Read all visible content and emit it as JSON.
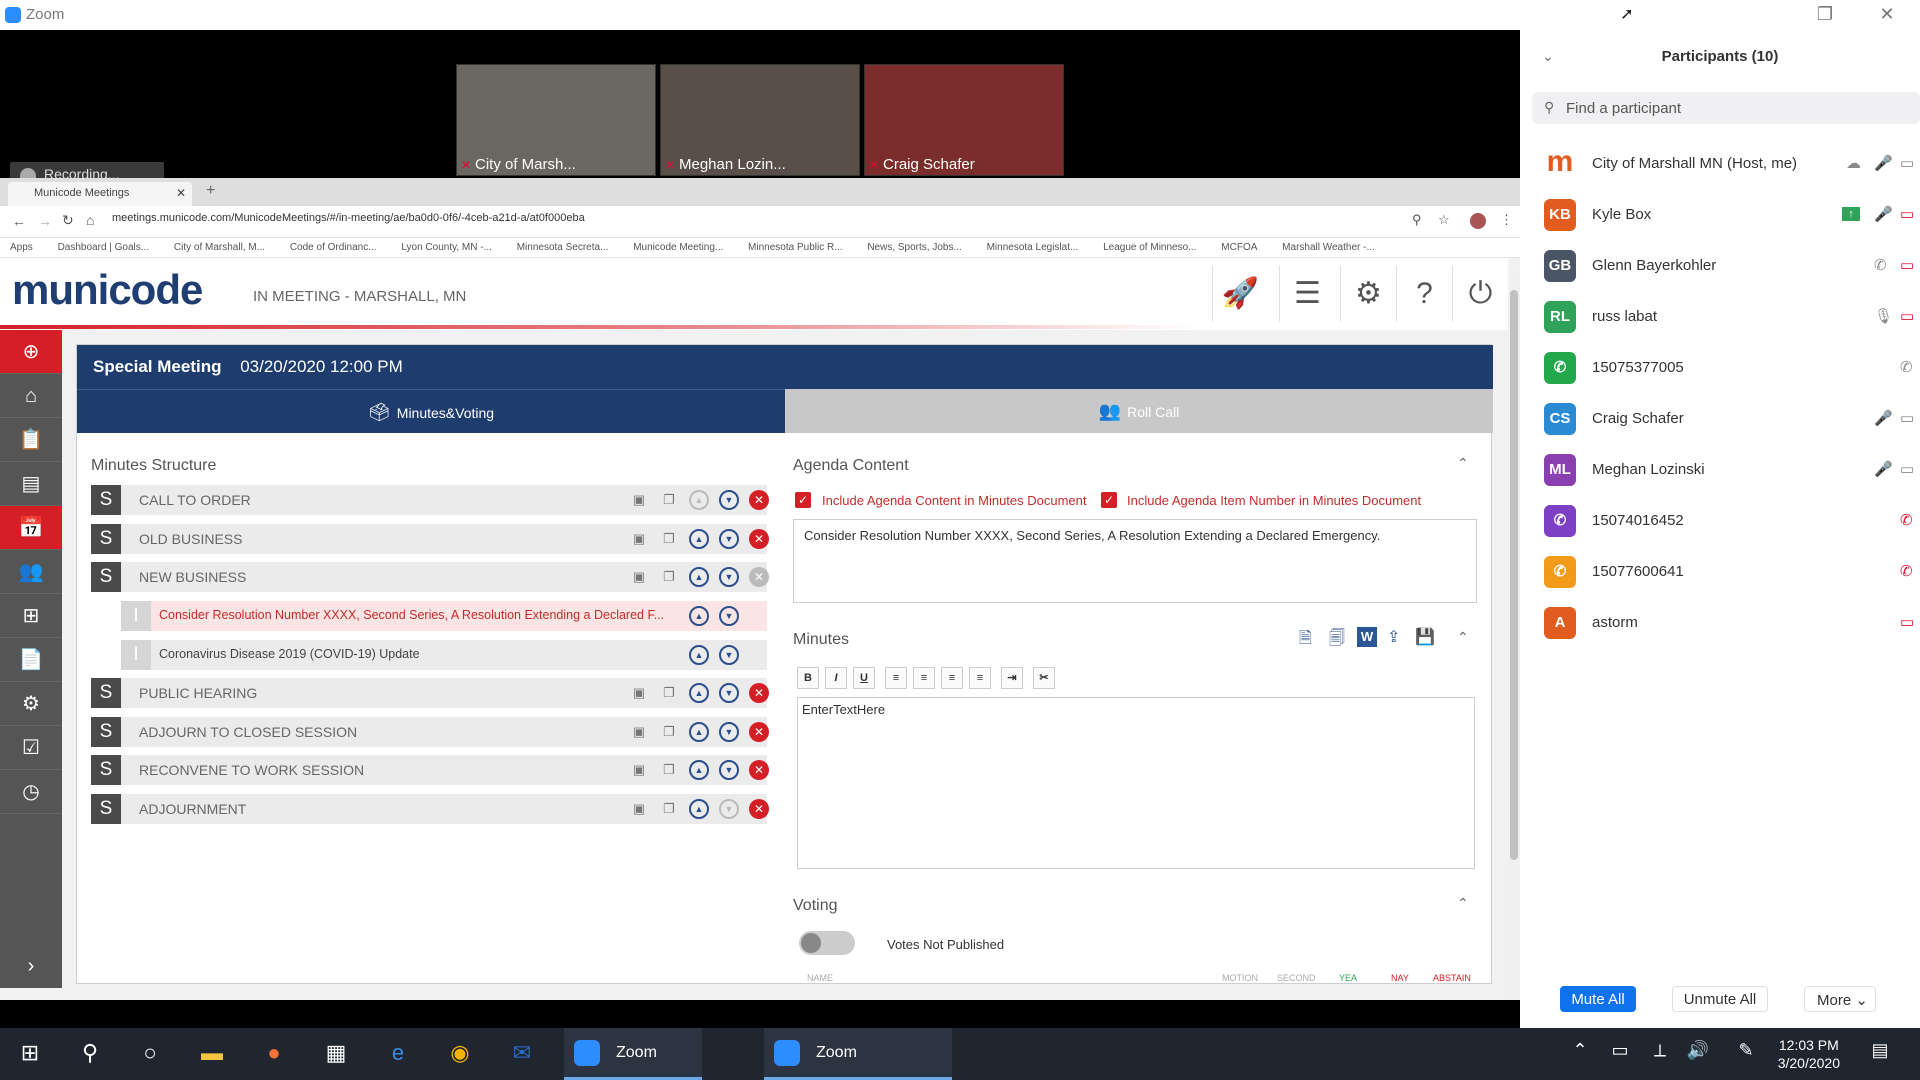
{
  "app": {
    "title": "Zoom"
  },
  "video": {
    "tiles": [
      {
        "name": "City of Marsh...",
        "bg": "#6a6660"
      },
      {
        "name": "Meghan Lozin...",
        "bg": "#5a4f48"
      },
      {
        "name": "Craig Schafer",
        "bg": "#7a2d2a"
      }
    ],
    "recording": "Recording..."
  },
  "browser": {
    "tab_title": "Municode Meetings",
    "url": "meetings.municode.com/MunicodeMeetings/#/in-meeting/ae/ba0d0-0f6/-4ceb-a21d-a/at0f000eba",
    "bookmarks": [
      "Apps",
      "Dashboard | Goals...",
      "City of Marshall, M...",
      "Code of Ordinanc...",
      "Lyon County, MN -...",
      "Minnesota Secreta...",
      "Municode Meeting...",
      "Minnesota Public R...",
      "News, Sports, Jobs...",
      "Minnesota Legislat...",
      "League of Minneso...",
      "MCFOA",
      "Marshall Weather -..."
    ]
  },
  "municode": {
    "logo": "municode",
    "subtitle": "IN MEETING - MARSHALL, MN",
    "meeting_type": "Special Meeting",
    "meeting_datetime": "03/20/2020 12:00 PM",
    "tab_minutes": "Minutes&Voting",
    "tab_rollcall": "Roll Call",
    "minutes_structure_title": "Minutes Structure",
    "structure": [
      {
        "badge": "S",
        "label": "CALL TO ORDER"
      },
      {
        "badge": "S",
        "label": "OLD BUSINESS"
      },
      {
        "badge": "S",
        "label": "NEW BUSINESS"
      },
      {
        "badge": "I",
        "label": "Consider Resolution Number XXXX, Second Series, A Resolution Extending a Declared F..."
      },
      {
        "badge": "I",
        "label": "Coronavirus Disease 2019 (COVID-19) Update"
      },
      {
        "badge": "S",
        "label": "PUBLIC HEARING"
      },
      {
        "badge": "S",
        "label": "ADJOURN TO CLOSED SESSION"
      },
      {
        "badge": "S",
        "label": "RECONVENE TO WORK SESSION"
      },
      {
        "badge": "S",
        "label": "ADJOURNMENT"
      }
    ],
    "agenda_title": "Agenda Content",
    "chk1": "Include Agenda Content in Minutes Document",
    "chk2": "Include Agenda Item Number in Minutes Document",
    "agenda_text": "Consider Resolution Number XXXX, Second Series, A Resolution Extending a Declared Emergency.",
    "minutes_title": "Minutes",
    "minutes_text": "EnterTextHere",
    "voting_title": "Voting",
    "votes_status": "Votes Not Published",
    "vote_cols": {
      "name": "NAME",
      "motion": "MOTION",
      "second": "SECOND",
      "yea": "YEA",
      "nay": "NAY",
      "abstain": "ABSTAIN"
    }
  },
  "participants": {
    "title": "Participants (10)",
    "search_placeholder": "Find a participant",
    "list": [
      {
        "initials": "m",
        "name": "City of Marshall MN (Host, me)",
        "color": "#ffffff"
      },
      {
        "initials": "KB",
        "name": "Kyle Box",
        "color": "#e35c1f"
      },
      {
        "initials": "GB",
        "name": "Glenn Bayerkohler",
        "color": "#4a5566"
      },
      {
        "initials": "RL",
        "name": "russ labat",
        "color": "#2fa35a"
      },
      {
        "initials": "",
        "name": "15075377005",
        "color": "#20a84a"
      },
      {
        "initials": "CS",
        "name": "Craig Schafer",
        "color": "#2a8ad4"
      },
      {
        "initials": "ML",
        "name": "Meghan Lozinski",
        "color": "#8a3fb0"
      },
      {
        "initials": "",
        "name": "15074016452",
        "color": "#7d3fc4"
      },
      {
        "initials": "",
        "name": "15077600641",
        "color": "#f29b19"
      },
      {
        "initials": "A",
        "name": "astorm",
        "color": "#e35c1f"
      }
    ],
    "mute_all": "Mute All",
    "unmute_all": "Unmute All",
    "more": "More"
  },
  "taskbar": {
    "zoom1": "Zoom",
    "zoom2": "Zoom",
    "time": "12:03 PM",
    "date": "3/20/2020"
  }
}
